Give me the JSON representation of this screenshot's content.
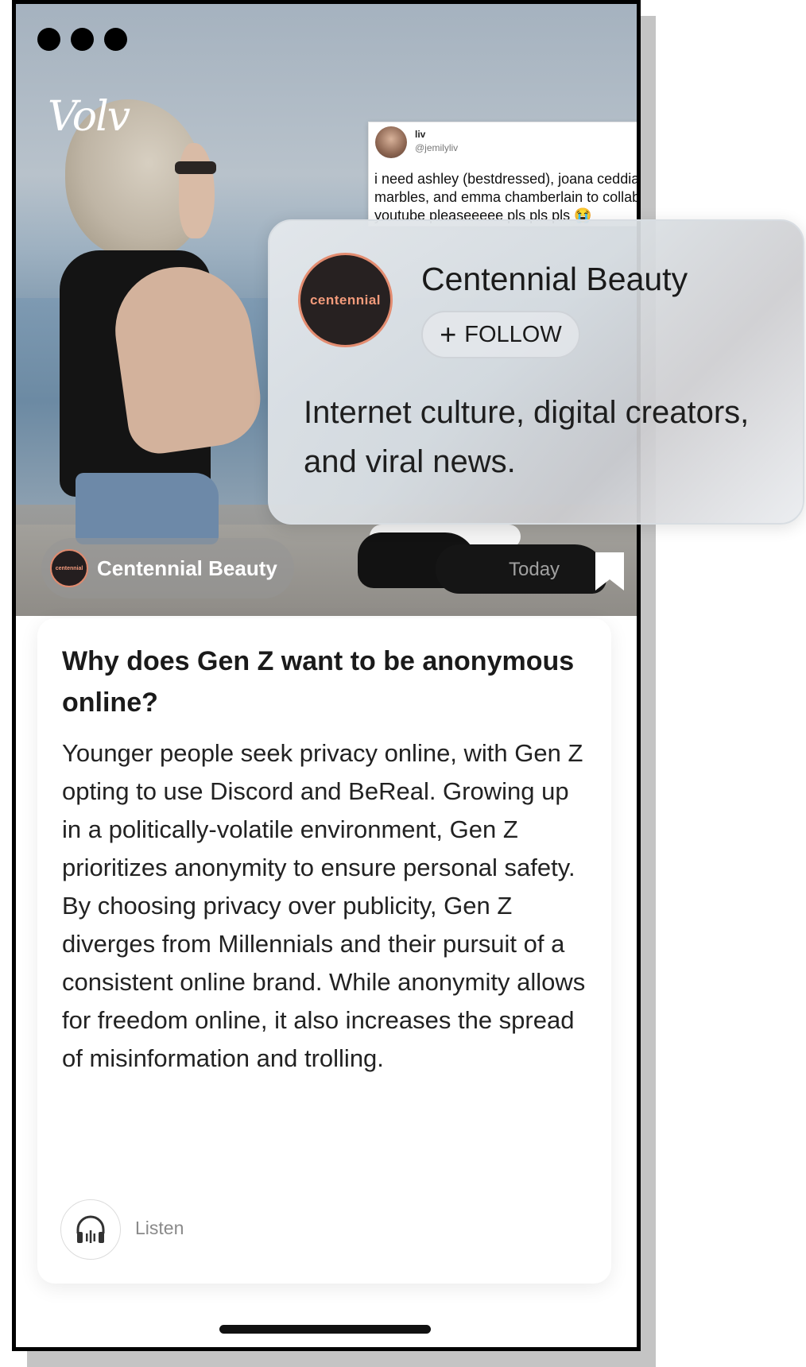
{
  "brand": {
    "logo_text": "Volv"
  },
  "tweet": {
    "name": "liv",
    "handle": "@jemilyliv",
    "text_lines": [
      "i need ashley (bestdressed), joana ceddia,",
      "marbles, and emma chamberlain to collab on",
      "youtube pleaseeeee pls pls pls 😭"
    ]
  },
  "source": {
    "avatar_text": "centennial",
    "name": "Centennial Beauty",
    "date": "Today"
  },
  "article": {
    "title": "Why does Gen Z want to be anonymous online?",
    "body": "Younger people seek privacy online, with Gen Z opting to use Discord and BeReal. Growing up in a politically-volatile environment, Gen Z prioritizes anonymity to ensure personal safety. By choosing privacy over publicity, Gen Z diverges from Millennials and their pursuit of a consistent online brand. While anonymity allows for freedom online, it also increases the spread of misinformation and trolling.",
    "listen_label": "Listen"
  },
  "publisher_card": {
    "avatar_text": "centennial",
    "name": "Centennial Beauty",
    "follow_label": "FOLLOW",
    "description": "Internet culture, digital creators, and viral news."
  },
  "icons": {
    "window_controls": "dots",
    "bookmark": "bookmark-icon",
    "listen": "headphones-icon",
    "follow": "plus-icon"
  },
  "colors": {
    "brand_accent": "#e38c70",
    "avatar_bg": "#272121",
    "text_primary": "#1a1a1a"
  }
}
